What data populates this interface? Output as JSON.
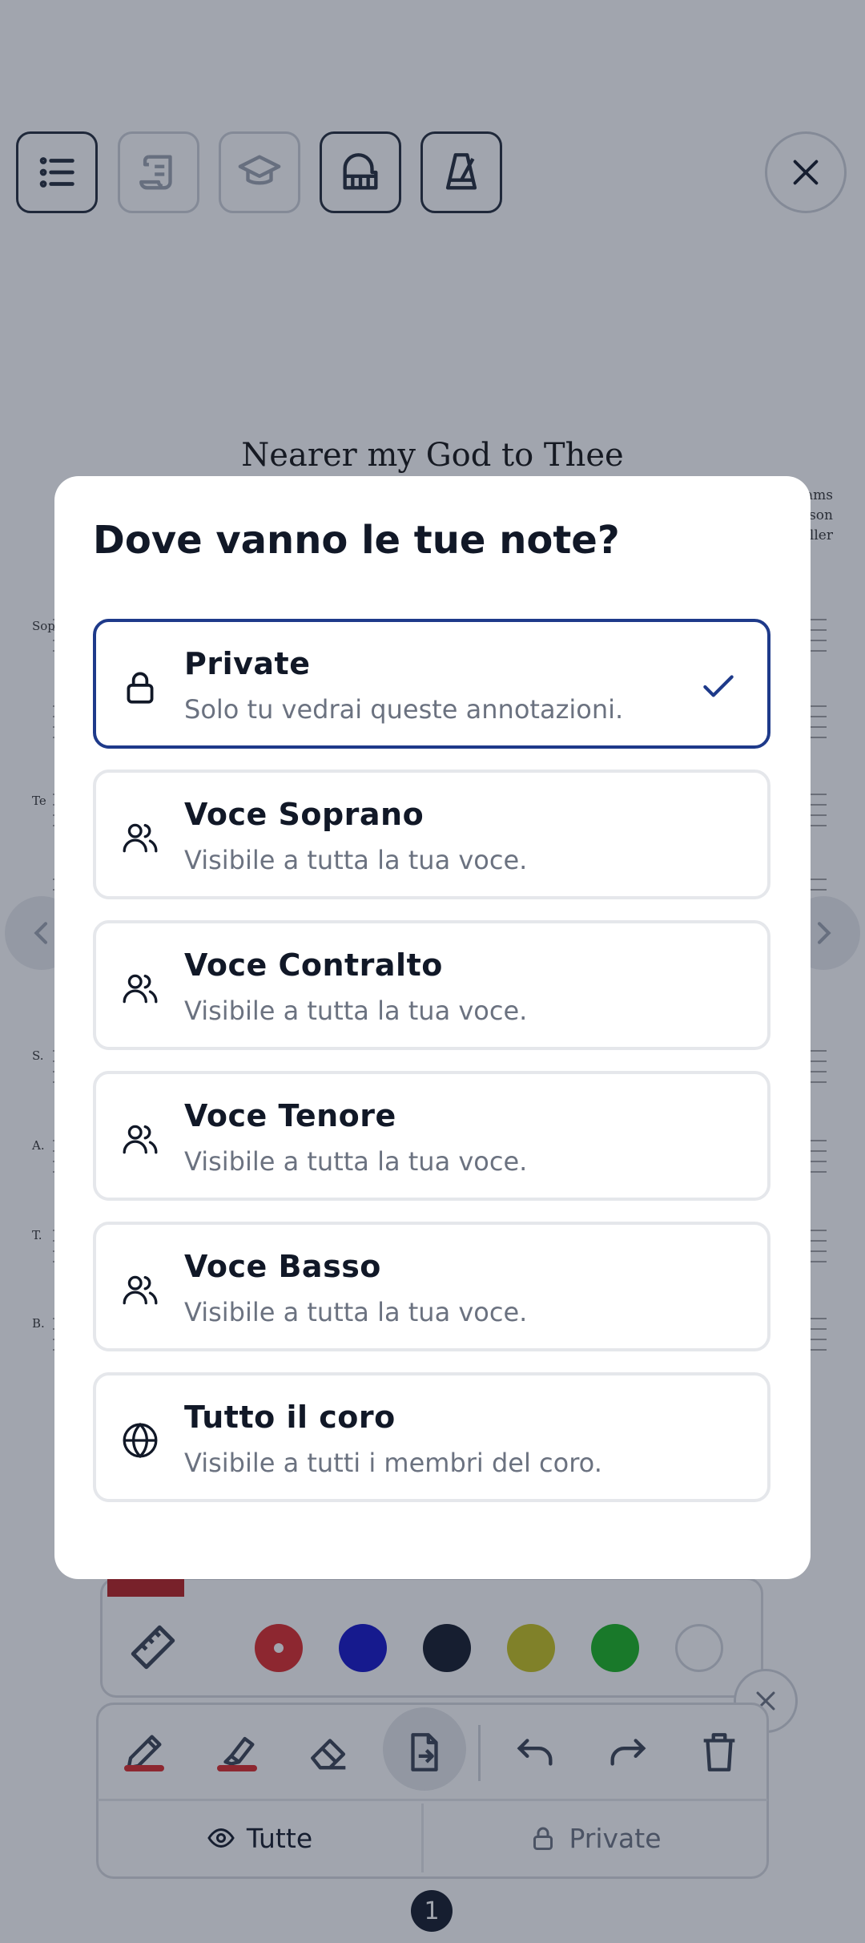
{
  "score": {
    "title": "Nearer my God to Thee",
    "parts_top": [
      "Sopr",
      "Te"
    ],
    "parts_bottom": [
      "S.",
      "A.",
      "T.",
      "B."
    ],
    "credits": [
      "ams",
      "son",
      "eller"
    ]
  },
  "toolbar_icons": [
    "list-icon",
    "scroll-icon",
    "graduation-cap-icon",
    "piano-icon",
    "metronome-icon"
  ],
  "colors": {
    "accent": "#1e3a8a",
    "swatches": [
      "#dc2626",
      "#1010c8",
      "#111827",
      "#c7c21a",
      "#16b31c",
      "#ffffff"
    ]
  },
  "filter_tabs": {
    "all": "Tutte",
    "private": "Private"
  },
  "page_indicator": "1",
  "dialog": {
    "title": "Dove vanno le tue note?",
    "options": [
      {
        "label": "Private",
        "description": "Solo tu vedrai queste annotazioni.",
        "icon": "lock-icon",
        "selected": true
      },
      {
        "label": "Voce Soprano",
        "description": "Visibile a tutta la tua voce.",
        "icon": "users-icon",
        "selected": false
      },
      {
        "label": "Voce Contralto",
        "description": "Visibile a tutta la tua voce.",
        "icon": "users-icon",
        "selected": false
      },
      {
        "label": "Voce Tenore",
        "description": "Visibile a tutta la tua voce.",
        "icon": "users-icon",
        "selected": false
      },
      {
        "label": "Voce Basso",
        "description": "Visibile a tutta la tua voce.",
        "icon": "users-icon",
        "selected": false
      },
      {
        "label": "Tutto il coro",
        "description": "Visibile a tutti i membri del coro.",
        "icon": "globe-icon",
        "selected": false
      }
    ]
  }
}
